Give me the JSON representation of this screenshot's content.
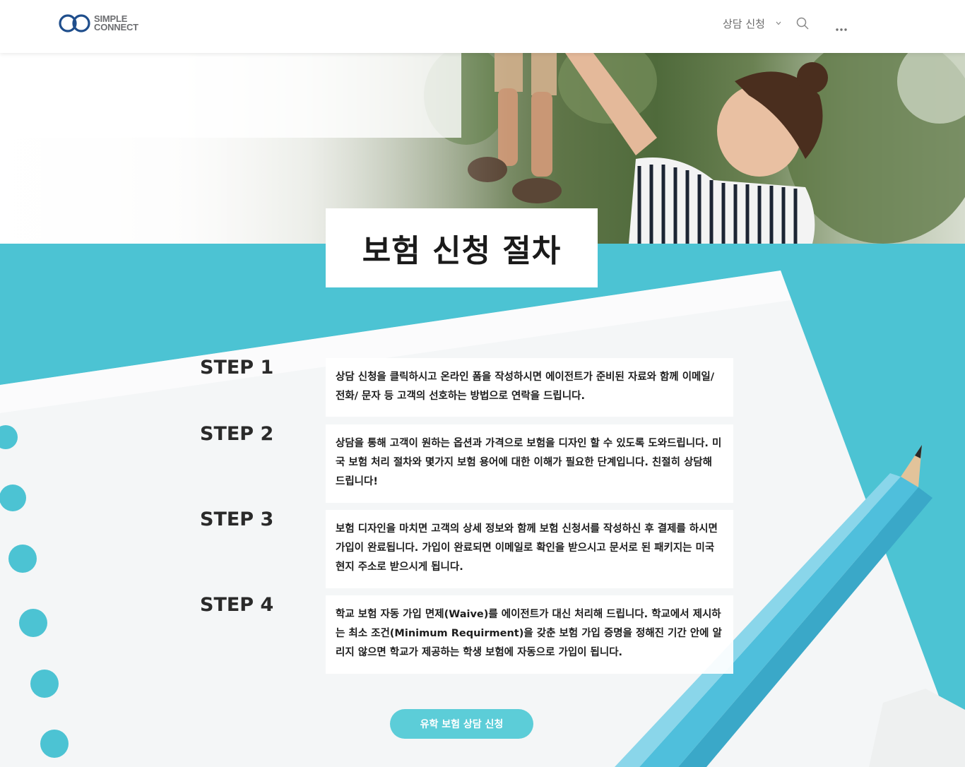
{
  "brand": {
    "logo_line1": "SIMPLE",
    "logo_line2": "CONNECT"
  },
  "nav": {
    "consult_label": "상담 신청",
    "icons": [
      "chevron-down-icon",
      "search-icon",
      "more-icon"
    ]
  },
  "page": {
    "title": "보험 신청 절차"
  },
  "steps": [
    {
      "label": "STEP 1",
      "text": "상담 신청을 클릭하시고 온라인 폼을 작성하시면 에이전트가 준비된 자료와 함께 이메일/전화/ 문자 등 고객의 선호하는 방법으로 연락을 드립니다."
    },
    {
      "label": "STEP 2",
      "text": "상담을 통해 고객이 원하는 옵션과 가격으로 보험을 디자인 할 수 있도록 도와드립니다. 미국 보험 처리 절차와 몇가지 보험 용어에 대한 이해가 필요한 단계입니다. 친절히 상담해 드립니다!"
    },
    {
      "label": "STEP 3",
      "text": "보험 디자인을 마치면 고객의 상세 정보와 함께 보험 신청서를 작성하신 후 결제를 하시면 가입이 완료됩니다. 가입이 완료되면 이메일로 확인을 받으시고 문서로 된 패키지는 미국 현지 주소로 받으시게 됩니다."
    },
    {
      "label": "STEP 4",
      "text": "학교 보험 자동 가입 면제(Waive)를 에이전트가 대신 처리해 드립니다. 학교에서 제시하는 최소 조건(Minimum Requirment)을 갖춘 보험 가입 증명을 정해진 기간 안에 알리지 않으면 학교가 제공하는 학생 보험에 자동으로 가입이 됩니다."
    }
  ],
  "cta": {
    "label": "유학 보험 상담 신청"
  },
  "colors": {
    "accent": "#5ccdd8",
    "section_bg": "#4cc3d3",
    "logo_blue": "#1f4e8c"
  }
}
